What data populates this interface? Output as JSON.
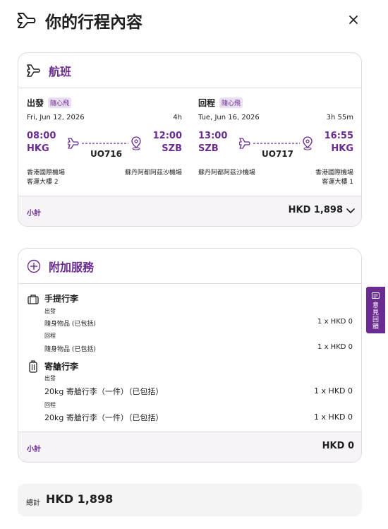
{
  "header": {
    "title": "你的行程內容",
    "icon": "plane-icon",
    "close_icon": "close-icon"
  },
  "flights": {
    "title": "航班",
    "legs": [
      {
        "direction": "出發",
        "tag": "隨心飛",
        "date": "Fri, Jun 12, 2026",
        "duration": "4h",
        "dep_time": "08:00",
        "arr_time": "12:00",
        "dep_code": "HKG",
        "arr_code": "SZB",
        "flight_no": "UO716",
        "dep_airport": "香港國際機場",
        "dep_terminal": "客運大樓 2",
        "arr_airport": "蘇丹阿都阿茲沙機場",
        "arr_terminal": ""
      },
      {
        "direction": "回程",
        "tag": "隨心飛",
        "date": "Tue, Jun 16, 2026",
        "duration": "3h 55m",
        "dep_time": "13:00",
        "arr_time": "16:55",
        "dep_code": "SZB",
        "arr_code": "HKG",
        "flight_no": "UO717",
        "dep_airport": "蘇丹阿都阿茲沙機場",
        "dep_terminal": "",
        "arr_airport": "香港國際機場",
        "arr_terminal": "客運大樓 1"
      }
    ],
    "subtotal_label": "小計",
    "subtotal_amount": "HKD 1,898"
  },
  "services": {
    "title": "附加服務",
    "carry_on": {
      "title": "手提行李",
      "out_label": "出發",
      "out_item": "隨身物品 (已包括)",
      "out_price": "1 x HKD 0",
      "ret_label": "回程",
      "ret_item": "隨身物品 (已包括)",
      "ret_price": "1 x HKD 0"
    },
    "checked": {
      "title": "寄艙行李",
      "out_label": "出發",
      "out_item": "20kg 寄艙行李（一件）（已包括）",
      "out_price": "1 x HKD 0",
      "ret_label": "回程",
      "ret_item": "20kg 寄艙行李（一件）（已包括）",
      "ret_price": "1 x HKD 0"
    },
    "subtotal_label": "小計",
    "subtotal_amount": "HKD 0"
  },
  "feedback_tab": {
    "label": "意見回饋"
  },
  "total": {
    "label": "總計",
    "amount": "HKD 1,898"
  },
  "colors": {
    "accent": "#6b2c91",
    "tag_bg": "#e9dff0",
    "bar_bg": "#f6f4f8",
    "total_bg": "#f4f4f4"
  }
}
